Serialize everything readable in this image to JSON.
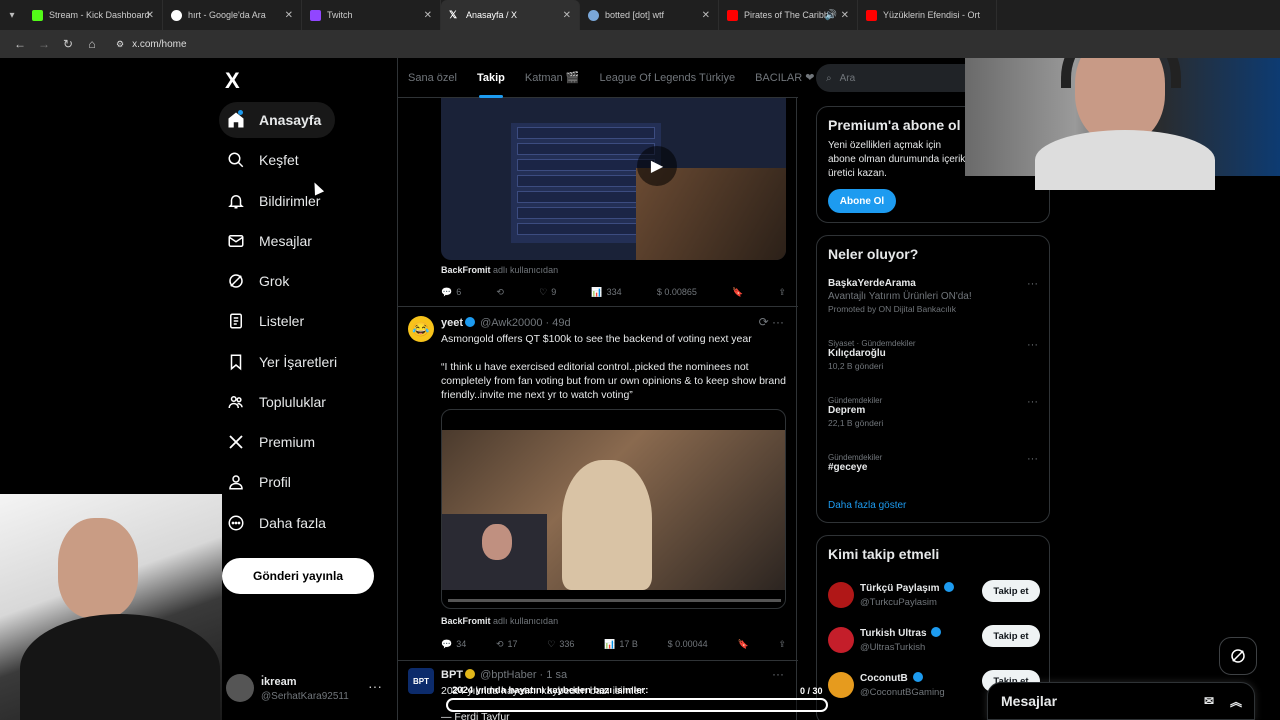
{
  "browser": {
    "tabs": [
      {
        "label": "Stream - Kick Dashboard",
        "color": "#53fc18"
      },
      {
        "label": "hırt - Google'da Ara",
        "color": "#ffffff"
      },
      {
        "label": "Twitch",
        "color": "#9146ff"
      },
      {
        "label": "Anasayfa / X",
        "color": "#ffffff",
        "active": true
      },
      {
        "label": "botted [dot] wtf",
        "color": "#7aa7d8"
      },
      {
        "label": "Pirates of The Caribbe",
        "color": "#ff0000"
      },
      {
        "label": "Yüzüklerin Efendisi - Ort",
        "color": "#ff0000"
      }
    ],
    "url": "x.com/home"
  },
  "sidebar": {
    "logo": "X",
    "items": [
      {
        "label": "Anasayfa",
        "icon": "home-icon"
      },
      {
        "label": "Keşfet",
        "icon": "search-icon"
      },
      {
        "label": "Bildirimler",
        "icon": "bell-icon"
      },
      {
        "label": "Mesajlar",
        "icon": "envelope-icon"
      },
      {
        "label": "Grok",
        "icon": "grok-icon"
      },
      {
        "label": "Listeler",
        "icon": "list-icon"
      },
      {
        "label": "Yer İşaretleri",
        "icon": "bookmark-icon"
      },
      {
        "label": "Topluluklar",
        "icon": "people-icon"
      },
      {
        "label": "Premium",
        "icon": "x-logo-icon"
      },
      {
        "label": "Profil",
        "icon": "person-icon"
      },
      {
        "label": "Daha fazla",
        "icon": "more-circle-icon"
      }
    ],
    "post_button": "Gönderi yayınla",
    "account": {
      "name": "ı̇kream",
      "handle": "@SerhatKara92511"
    }
  },
  "timeline": {
    "tabs": [
      "Sana özel",
      "Takip",
      "Katman 🎬",
      "League Of Legends Türkiye",
      "BACILAR ❤"
    ],
    "active_tab": "Takip",
    "post1": {
      "source_name": "BackFromit",
      "source_suffix": "adlı kullanıcıdan",
      "replies": "6",
      "reposts": "",
      "likes": "9",
      "views": "334",
      "earnings": "$ 0.00865"
    },
    "post2": {
      "name": "yeet",
      "handle": "@Awk20000",
      "time": "· 49d",
      "text": "Asmongold offers QT $100k to see the backend of voting next year",
      "quote": "“I think u have exercised editorial control..picked the nominees not completely from fan voting but from ur own opinions & to keep show brand friendly..invite me next yr to watch voting”",
      "source_name": "BackFromit",
      "source_suffix": "adlı kullanıcıdan",
      "replies": "34",
      "reposts": "17",
      "likes": "336",
      "views": "17 B",
      "earnings": "$ 0.00044"
    },
    "post3": {
      "name": "BPT",
      "handle": "@bptHaber",
      "time": "· 1 sa",
      "text": "2024 yılında hayatını kaybeden bazı isimler:",
      "line2": "— Ferdi Tayfur"
    }
  },
  "rightcol": {
    "search_placeholder": "Ara",
    "premium": {
      "title": "Premium'a abone ol",
      "text": "Yeni özellikleri açmak için abone olman durumunda içerik üretici kazan.",
      "button": "Abone Ol"
    },
    "trends": {
      "title": "Neler oluyor?",
      "items": [
        {
          "cat": "",
          "title": "BaşkaYerdeArama",
          "sub": "Avantajlı Yatırım Ürünleri ON'da!",
          "count": "Promoted by ON Dijital Bankacılık"
        },
        {
          "cat": "Siyaset · Gündemdekiler",
          "title": "Kılıçdaroğlu",
          "sub": "",
          "count": "10,2 B gönderi"
        },
        {
          "cat": "Gündemdekiler",
          "title": "Deprem",
          "sub": "",
          "count": "22,1 B gönderi"
        },
        {
          "cat": "Gündemdekiler",
          "title": "#geceye",
          "sub": "",
          "count": ""
        }
      ],
      "more": "Daha fazla göster"
    },
    "who_to_follow": {
      "title": "Kimi takip etmeli",
      "items": [
        {
          "name": "Türkçü Paylaşım",
          "handle": "@TurkcuPaylasim",
          "button": "Takip et",
          "color": "#b01717"
        },
        {
          "name": "Turkish Ultras",
          "handle": "@UltrasTurkish",
          "button": "Takip et",
          "color": "#c41e2a"
        },
        {
          "name": "CoconutB",
          "handle": "@CoconutBGaming",
          "button": "Takip et",
          "color": "#e69b1e"
        }
      ]
    }
  },
  "messages": {
    "label": "Mesajlar"
  },
  "overlay": {
    "text": "2024 yılında hayatını kaybeden bazı isimler:",
    "counter": "0 / 30"
  }
}
